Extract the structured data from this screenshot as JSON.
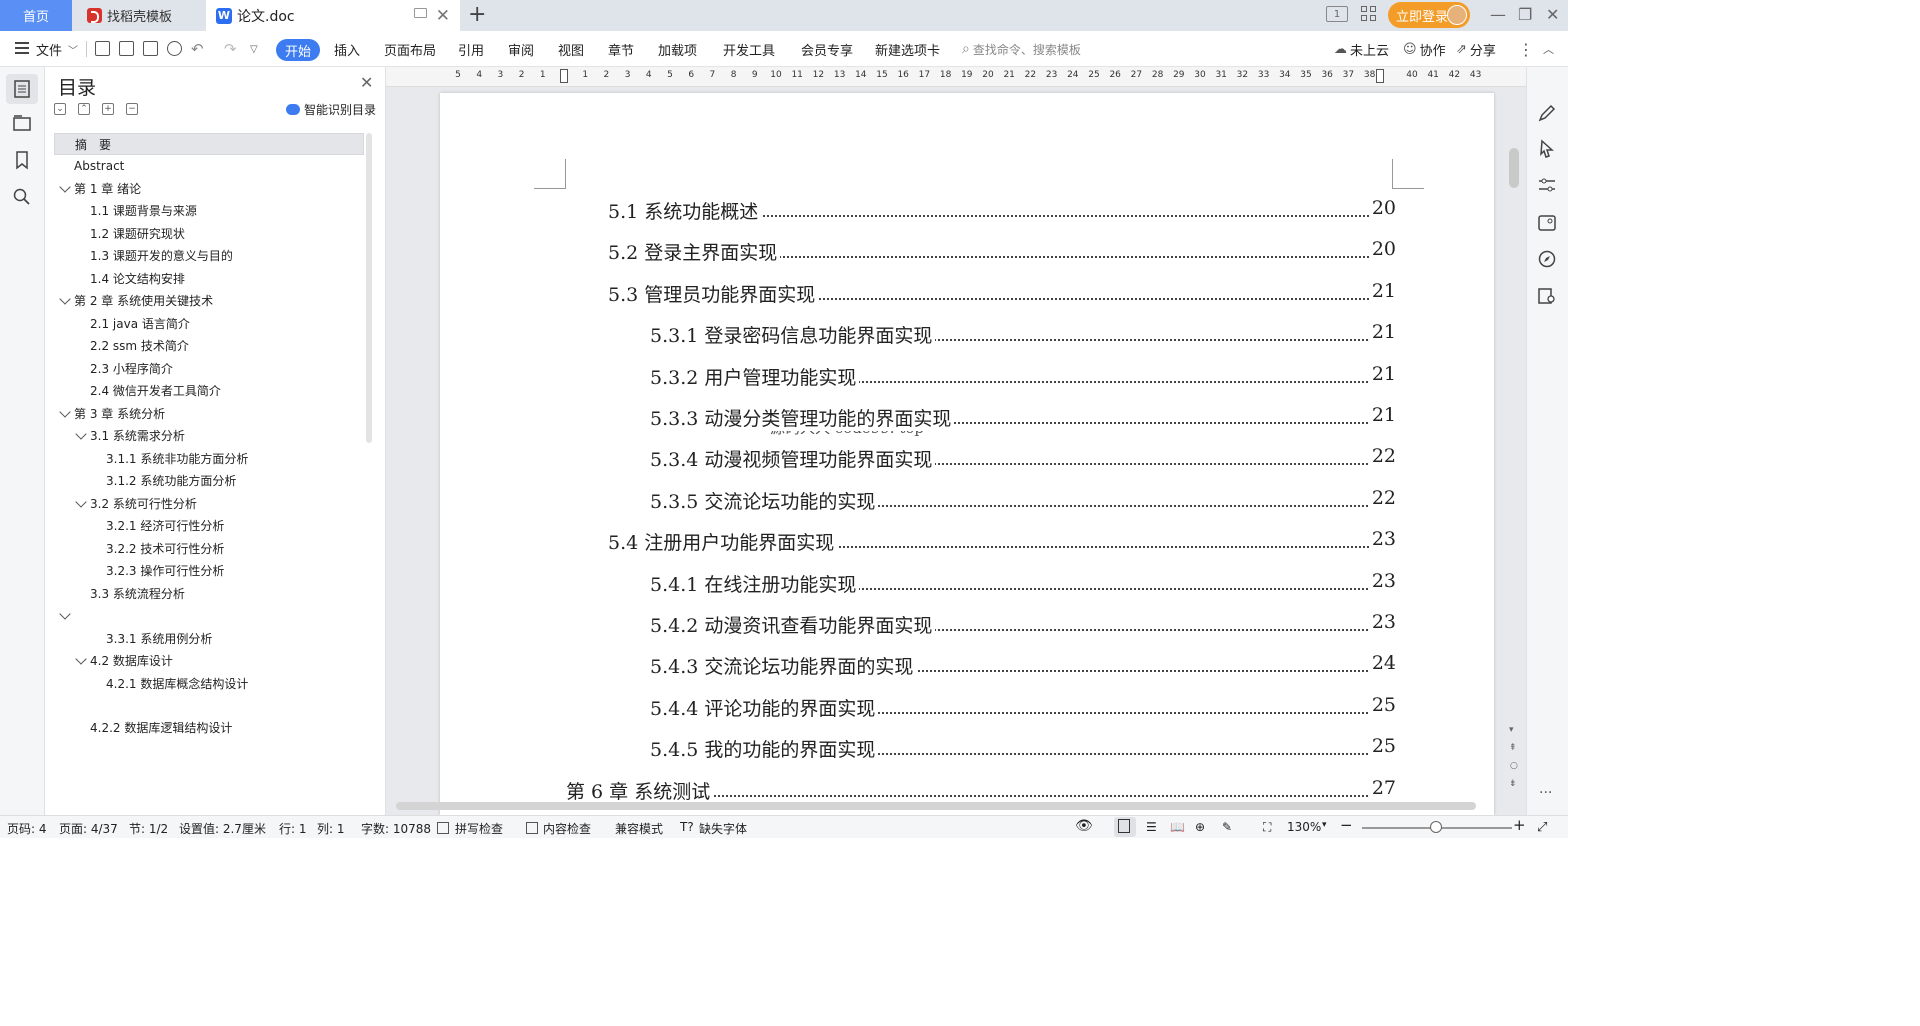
{
  "tabs": {
    "home": "首页",
    "template": "找稻壳模板",
    "doc": "论文.doc"
  },
  "titlebar": {
    "login": "立即登录"
  },
  "toolbar": {
    "file": "文件",
    "ribbon_tabs": [
      "开始",
      "插入",
      "页面布局",
      "引用",
      "审阅",
      "视图",
      "章节",
      "加载项",
      "开发工具",
      "会员专享",
      "新建选项卡"
    ],
    "search_placeholder": "查找命令、搜索模板",
    "cloud": "未上云",
    "collab": "协作",
    "share": "分享"
  },
  "nav": {
    "title": "目录",
    "smart": "智能识别目录",
    "items": [
      "摘　要",
      "Abstract",
      "第 1 章  绪论",
      "1.1    课题背景与来源",
      "1.2  课题研究现状",
      "1.3 课题开发的意义与目的",
      "1.4 论文结构安排",
      "第 2 章  系统使用关键技术",
      "2.1 java 语言简介",
      "2.2 ssm 技术简介",
      "2.3  小程序简介",
      "2.4  微信开发者工具简介",
      "第 3 章  系统分析",
      "3.1  系统需求分析",
      "3.1.1 系统非功能方面分析",
      "3.1.2 系统功能方面分析",
      "3.2 系统可行性分析",
      "3.2.1  经济可行性分析",
      "3.2.2    技术可行性分析",
      "3.2.3    操作可行性分析",
      "3.3 系统流程分析",
      "",
      "3.3.1 系统用例分析",
      "4.2 数据库设计",
      "4.2.1 数据库概念结构设计",
      "4.2.2 数据库逻辑结构设计"
    ]
  },
  "ruler": {
    "left_ticks": [
      "5",
      "4",
      "3",
      "2",
      "1"
    ],
    "right_ticks": [
      "1",
      "2",
      "3",
      "4",
      "5",
      "6",
      "7",
      "8",
      "9",
      "10",
      "11",
      "12",
      "13",
      "14",
      "15",
      "16",
      "17",
      "18",
      "19",
      "20",
      "21",
      "22",
      "23",
      "24",
      "25",
      "26",
      "27",
      "28",
      "29",
      "30",
      "31",
      "32",
      "33",
      "34",
      "35",
      "36",
      "37",
      "38",
      "40",
      "41",
      "42",
      "43"
    ]
  },
  "document": {
    "lines": [
      {
        "text": "5.1 系统功能概述",
        "page": "20"
      },
      {
        "text": "5.2 登录主界面实现",
        "page": "20"
      },
      {
        "text": "5.3 管理员功能界面实现",
        "page": "21"
      },
      {
        "text": "5.3.1 登录密码信息功能界面实现",
        "page": "21"
      },
      {
        "text": "5.3.2 用户管理功能实现",
        "page": "21"
      },
      {
        "text": "5.3.3 动漫分类管理功能的界面实现",
        "page": "21"
      },
      {
        "text": "5.3.4 动漫视频管理功能界面实现",
        "page": "22"
      },
      {
        "text": "5.3.5 交流论坛功能的实现",
        "page": "22"
      },
      {
        "text": "5.4 注册用户功能界面实现",
        "page": "23"
      },
      {
        "text": "5.4.1 在线注册功能实现",
        "page": "23"
      },
      {
        "text": "5.4.2 动漫资讯查看功能界面实现",
        "page": "23"
      },
      {
        "text": "5.4.3 交流论坛功能界面的实现",
        "page": "24"
      },
      {
        "text": "5.4.4 评论功能的界面实现",
        "page": "25"
      },
      {
        "text": "5.4.5 我的功能的界面实现",
        "page": "25"
      },
      {
        "text": "第 6 章  系统测试",
        "page": "27"
      }
    ],
    "watermark": "源码人人  code99. top"
  },
  "status": {
    "page_code": "页码: 4",
    "pages": "页面: 4/37",
    "section": "节: 1/2",
    "setting": "设置值: 2.7厘米",
    "row": "行: 1",
    "col": "列: 1",
    "words": "字数: 10788",
    "spell": "拼写检查",
    "content": "内容检查",
    "compat": "兼容模式",
    "missing_font": "缺失字体",
    "zoom": "130%"
  }
}
